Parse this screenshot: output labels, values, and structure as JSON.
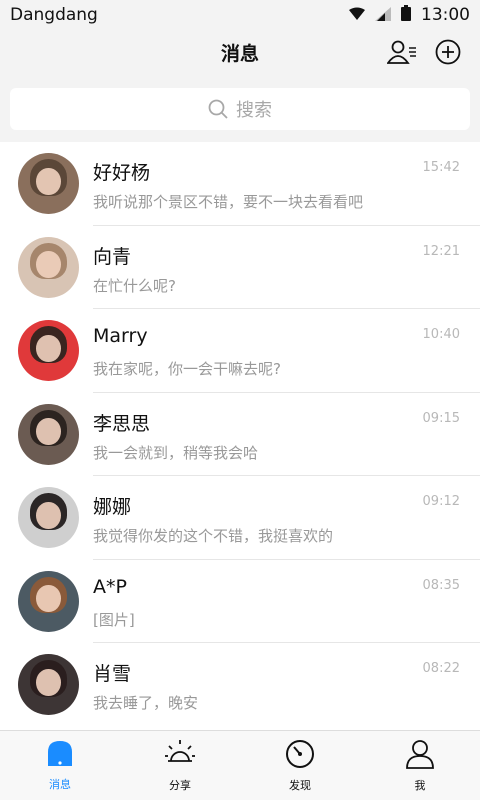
{
  "status": {
    "carrier": "Dangdang",
    "time": "13:00"
  },
  "nav": {
    "title": "消息"
  },
  "search": {
    "placeholder": "搜索"
  },
  "conversations": [
    {
      "name": "好好杨",
      "message": "我听说那个景区不错，要不一块去看看吧",
      "time": "15:42",
      "avatar_bg": "#8a6f5c",
      "avatar_hair": "#5b4738"
    },
    {
      "name": "向青",
      "message": "在忙什么呢?",
      "time": "12:21",
      "avatar_bg": "#d8c4b4",
      "avatar_hair": "#a6866c"
    },
    {
      "name": "Marry",
      "message": "我在家呢，你一会干嘛去呢?",
      "time": "10:40",
      "avatar_bg": "#e0393a",
      "avatar_hair": "#3a2520"
    },
    {
      "name": "李思思",
      "message": "我一会就到，稍等我会哈",
      "time": "09:15",
      "avatar_bg": "#6b5b52",
      "avatar_hair": "#2c2420"
    },
    {
      "name": "娜娜",
      "message": "我觉得你发的这个不错，我挺喜欢的",
      "time": "09:12",
      "avatar_bg": "#cfcfcf",
      "avatar_hair": "#2b2626"
    },
    {
      "name": "A*P",
      "message": "[图片]",
      "time": "08:35",
      "avatar_bg": "#4c5a63",
      "avatar_hair": "#8a5a3a"
    },
    {
      "name": "肖雪",
      "message": "我去睡了，晚安",
      "time": "08:22",
      "avatar_bg": "#3d3535",
      "avatar_hair": "#2a1e1e"
    }
  ],
  "tabs": [
    {
      "label": "消息",
      "icon": "message-bubble-icon",
      "active": true
    },
    {
      "label": "分享",
      "icon": "sun-icon",
      "active": false
    },
    {
      "label": "发现",
      "icon": "compass-icon",
      "active": false
    },
    {
      "label": "我",
      "icon": "person-icon",
      "active": false
    }
  ],
  "colors": {
    "accent": "#1a8cff",
    "background": "#f3f3f3"
  }
}
